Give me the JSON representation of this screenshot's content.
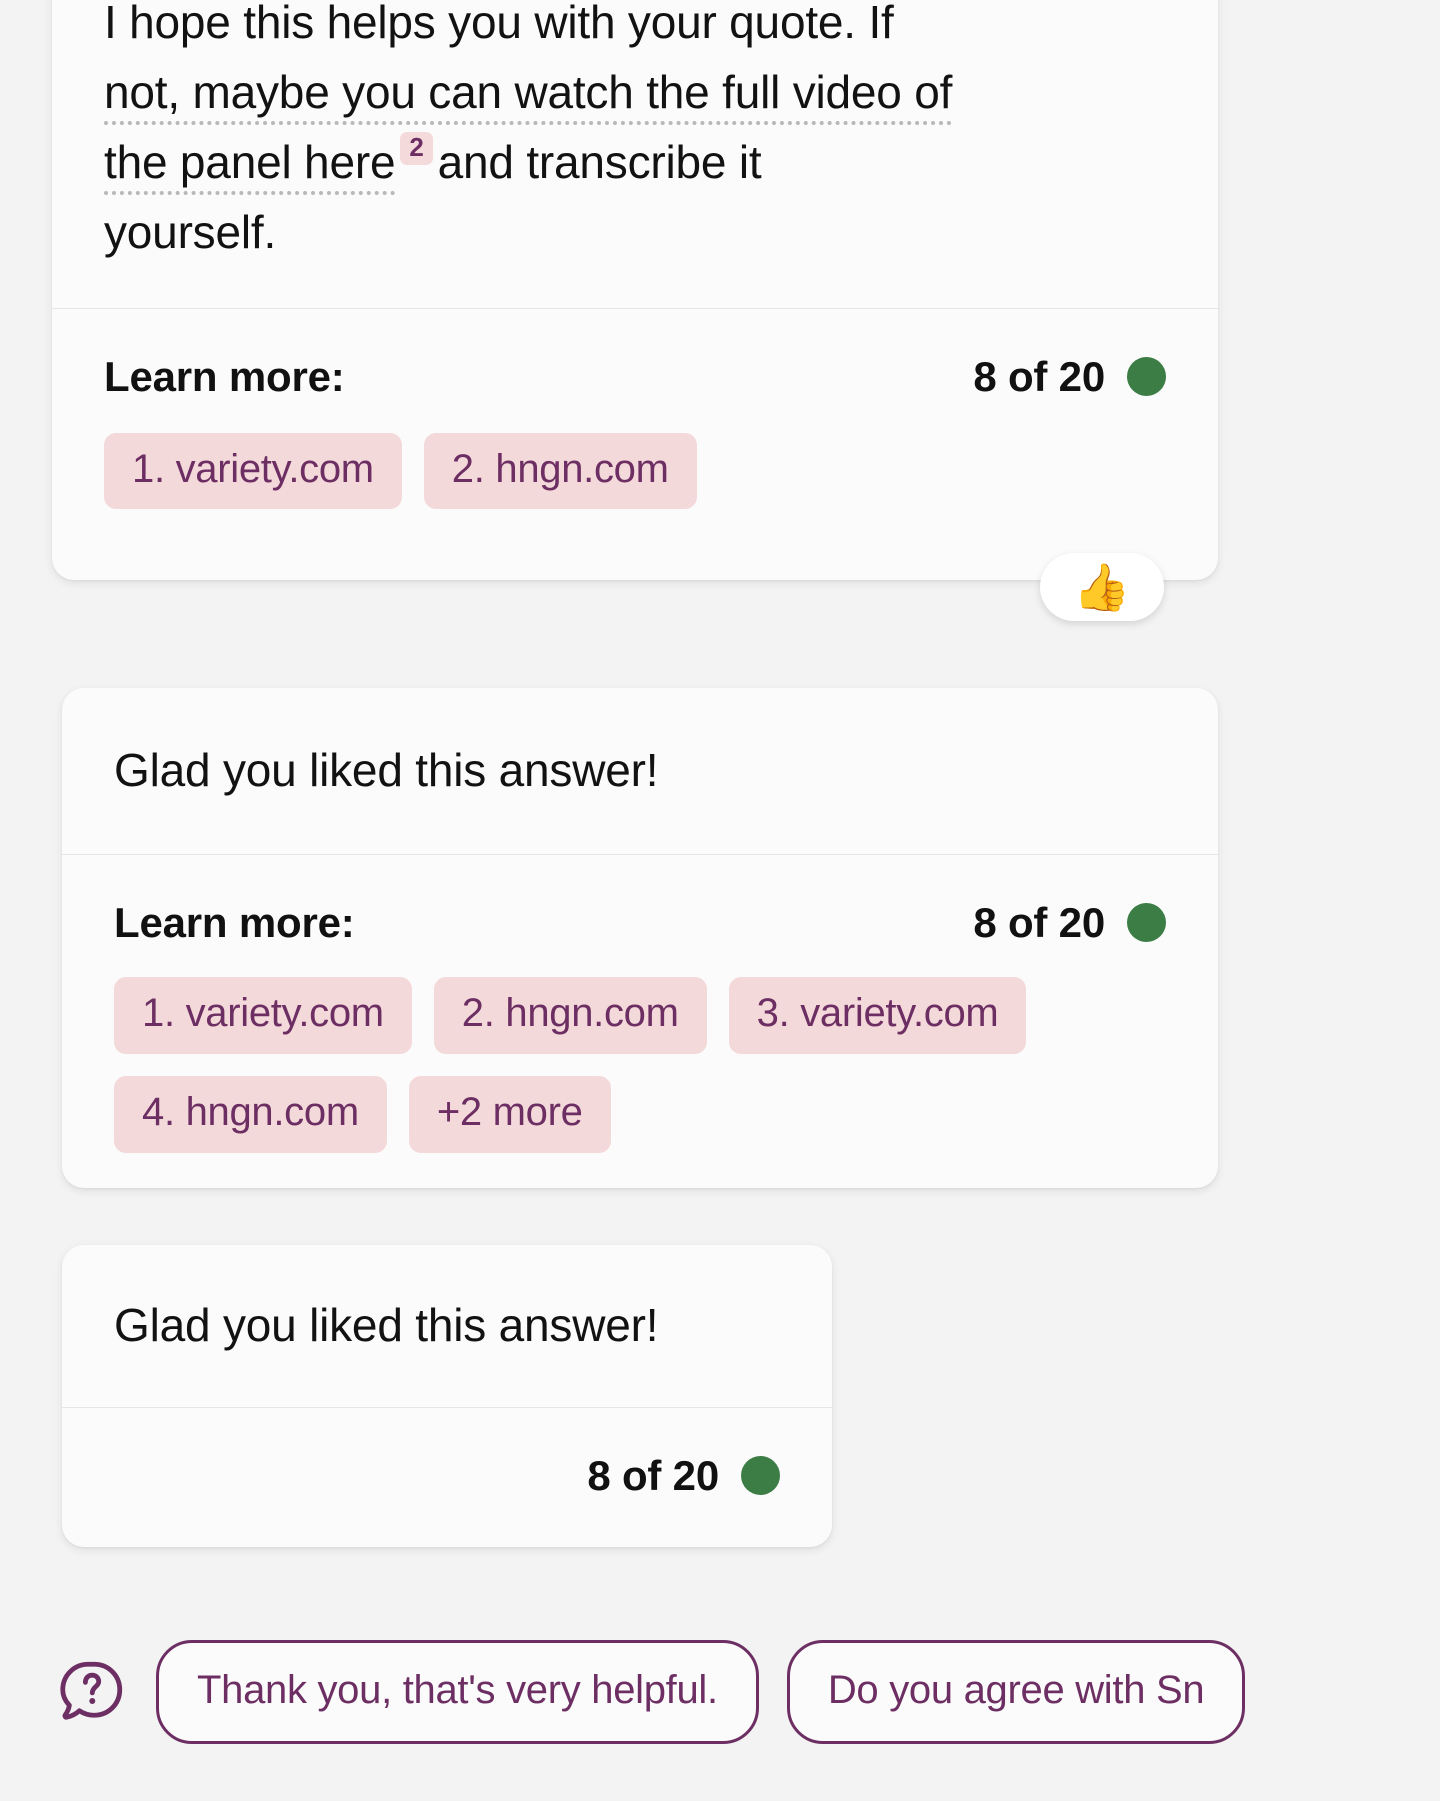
{
  "colors": {
    "page_background": "#f3f3f3",
    "card_background": "#fbfbfb",
    "accent_purple": "#6d2f63",
    "chip_pink": "#f3d9da",
    "status_green": "#3c7d46",
    "divider": "#e6e6e6"
  },
  "messages": [
    {
      "type": "assistant-answer",
      "text_segments": [
        {
          "text": "I hope this helps you with your quote. If",
          "cited": false
        },
        {
          "text": "not, maybe you can watch the full video of",
          "cited": true
        },
        {
          "text": "the panel here",
          "cited": true
        },
        {
          "text": "2",
          "cited": false,
          "is_citation_badge": true
        },
        {
          "text": "and transcribe it",
          "cited": false
        },
        {
          "text": "yourself.",
          "cited": false
        }
      ],
      "footer": {
        "learn_more_label": "Learn more:",
        "count_label": "8 of 20",
        "status_dot": "green-dot",
        "sources": [
          "1. variety.com",
          "2. hngn.com"
        ]
      },
      "reaction": {
        "emoji": "👍",
        "name": "thumbs-up-reaction"
      }
    },
    {
      "type": "assistant-followup",
      "headline": "Glad you liked this answer!",
      "footer": {
        "learn_more_label": "Learn more:",
        "count_label": "8 of 20",
        "status_dot": "green-dot",
        "sources": [
          "1. variety.com",
          "2. hngn.com",
          "3. variety.com",
          "4. hngn.com",
          "+2 more"
        ]
      }
    },
    {
      "type": "assistant-followup-compact",
      "headline": "Glad you liked this answer!",
      "footer": {
        "count_label": "8 of 20",
        "status_dot": "green-dot"
      }
    }
  ],
  "suggestions": {
    "icon": "question-bubble-icon",
    "chips": [
      "Thank you, that's very helpful.",
      "Do you agree with Sn"
    ]
  }
}
